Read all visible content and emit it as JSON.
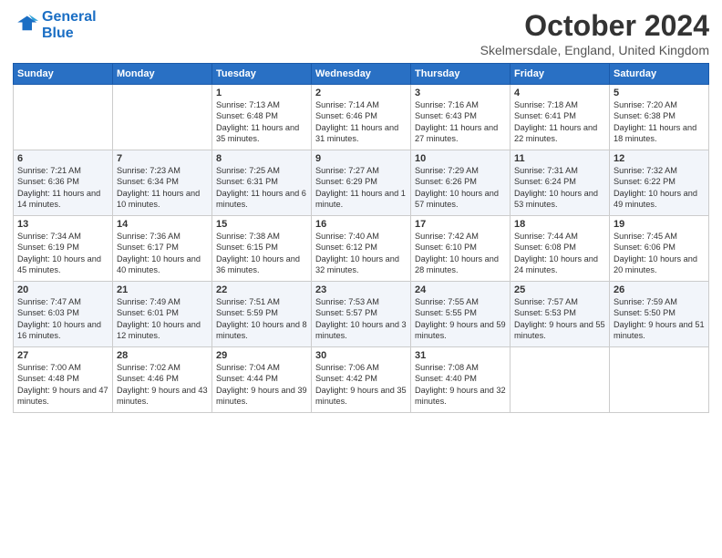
{
  "header": {
    "logo_line1": "General",
    "logo_line2": "Blue",
    "month": "October 2024",
    "location": "Skelmersdale, England, United Kingdom"
  },
  "days_of_week": [
    "Sunday",
    "Monday",
    "Tuesday",
    "Wednesday",
    "Thursday",
    "Friday",
    "Saturday"
  ],
  "weeks": [
    [
      {
        "day": "",
        "info": ""
      },
      {
        "day": "",
        "info": ""
      },
      {
        "day": "1",
        "info": "Sunrise: 7:13 AM\nSunset: 6:48 PM\nDaylight: 11 hours\nand 35 minutes."
      },
      {
        "day": "2",
        "info": "Sunrise: 7:14 AM\nSunset: 6:46 PM\nDaylight: 11 hours\nand 31 minutes."
      },
      {
        "day": "3",
        "info": "Sunrise: 7:16 AM\nSunset: 6:43 PM\nDaylight: 11 hours\nand 27 minutes."
      },
      {
        "day": "4",
        "info": "Sunrise: 7:18 AM\nSunset: 6:41 PM\nDaylight: 11 hours\nand 22 minutes."
      },
      {
        "day": "5",
        "info": "Sunrise: 7:20 AM\nSunset: 6:38 PM\nDaylight: 11 hours\nand 18 minutes."
      }
    ],
    [
      {
        "day": "6",
        "info": "Sunrise: 7:21 AM\nSunset: 6:36 PM\nDaylight: 11 hours\nand 14 minutes."
      },
      {
        "day": "7",
        "info": "Sunrise: 7:23 AM\nSunset: 6:34 PM\nDaylight: 11 hours\nand 10 minutes."
      },
      {
        "day": "8",
        "info": "Sunrise: 7:25 AM\nSunset: 6:31 PM\nDaylight: 11 hours\nand 6 minutes."
      },
      {
        "day": "9",
        "info": "Sunrise: 7:27 AM\nSunset: 6:29 PM\nDaylight: 11 hours\nand 1 minute."
      },
      {
        "day": "10",
        "info": "Sunrise: 7:29 AM\nSunset: 6:26 PM\nDaylight: 10 hours\nand 57 minutes."
      },
      {
        "day": "11",
        "info": "Sunrise: 7:31 AM\nSunset: 6:24 PM\nDaylight: 10 hours\nand 53 minutes."
      },
      {
        "day": "12",
        "info": "Sunrise: 7:32 AM\nSunset: 6:22 PM\nDaylight: 10 hours\nand 49 minutes."
      }
    ],
    [
      {
        "day": "13",
        "info": "Sunrise: 7:34 AM\nSunset: 6:19 PM\nDaylight: 10 hours\nand 45 minutes."
      },
      {
        "day": "14",
        "info": "Sunrise: 7:36 AM\nSunset: 6:17 PM\nDaylight: 10 hours\nand 40 minutes."
      },
      {
        "day": "15",
        "info": "Sunrise: 7:38 AM\nSunset: 6:15 PM\nDaylight: 10 hours\nand 36 minutes."
      },
      {
        "day": "16",
        "info": "Sunrise: 7:40 AM\nSunset: 6:12 PM\nDaylight: 10 hours\nand 32 minutes."
      },
      {
        "day": "17",
        "info": "Sunrise: 7:42 AM\nSunset: 6:10 PM\nDaylight: 10 hours\nand 28 minutes."
      },
      {
        "day": "18",
        "info": "Sunrise: 7:44 AM\nSunset: 6:08 PM\nDaylight: 10 hours\nand 24 minutes."
      },
      {
        "day": "19",
        "info": "Sunrise: 7:45 AM\nSunset: 6:06 PM\nDaylight: 10 hours\nand 20 minutes."
      }
    ],
    [
      {
        "day": "20",
        "info": "Sunrise: 7:47 AM\nSunset: 6:03 PM\nDaylight: 10 hours\nand 16 minutes."
      },
      {
        "day": "21",
        "info": "Sunrise: 7:49 AM\nSunset: 6:01 PM\nDaylight: 10 hours\nand 12 minutes."
      },
      {
        "day": "22",
        "info": "Sunrise: 7:51 AM\nSunset: 5:59 PM\nDaylight: 10 hours\nand 8 minutes."
      },
      {
        "day": "23",
        "info": "Sunrise: 7:53 AM\nSunset: 5:57 PM\nDaylight: 10 hours\nand 3 minutes."
      },
      {
        "day": "24",
        "info": "Sunrise: 7:55 AM\nSunset: 5:55 PM\nDaylight: 9 hours\nand 59 minutes."
      },
      {
        "day": "25",
        "info": "Sunrise: 7:57 AM\nSunset: 5:53 PM\nDaylight: 9 hours\nand 55 minutes."
      },
      {
        "day": "26",
        "info": "Sunrise: 7:59 AM\nSunset: 5:50 PM\nDaylight: 9 hours\nand 51 minutes."
      }
    ],
    [
      {
        "day": "27",
        "info": "Sunrise: 7:00 AM\nSunset: 4:48 PM\nDaylight: 9 hours\nand 47 minutes."
      },
      {
        "day": "28",
        "info": "Sunrise: 7:02 AM\nSunset: 4:46 PM\nDaylight: 9 hours\nand 43 minutes."
      },
      {
        "day": "29",
        "info": "Sunrise: 7:04 AM\nSunset: 4:44 PM\nDaylight: 9 hours\nand 39 minutes."
      },
      {
        "day": "30",
        "info": "Sunrise: 7:06 AM\nSunset: 4:42 PM\nDaylight: 9 hours\nand 35 minutes."
      },
      {
        "day": "31",
        "info": "Sunrise: 7:08 AM\nSunset: 4:40 PM\nDaylight: 9 hours\nand 32 minutes."
      },
      {
        "day": "",
        "info": ""
      },
      {
        "day": "",
        "info": ""
      }
    ]
  ]
}
